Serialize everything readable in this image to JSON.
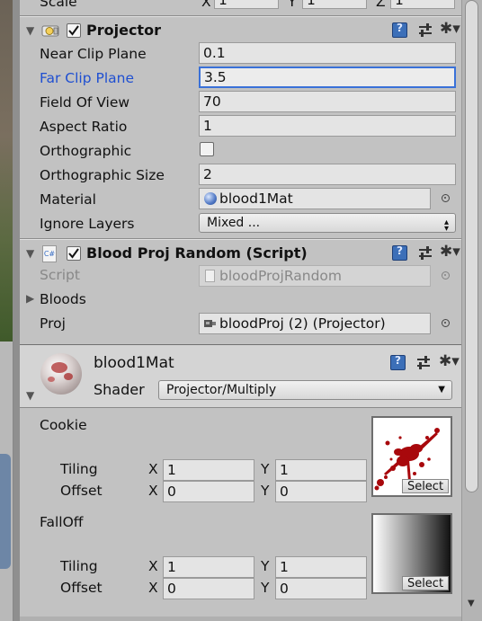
{
  "transform": {
    "scale_label": "Scale",
    "x_label": "X",
    "x_value": "1",
    "y_label": "Y",
    "y_value": "1",
    "z_label": "Z",
    "z_value": "1"
  },
  "projector": {
    "title": "Projector",
    "enabled": true,
    "fields": [
      {
        "label": "Near Clip Plane",
        "value": "0.1"
      },
      {
        "label": "Far Clip Plane",
        "value": "3.5"
      },
      {
        "label": "Field Of View",
        "value": "70"
      },
      {
        "label": "Aspect Ratio",
        "value": "1"
      },
      {
        "label": "Orthographic",
        "value": ""
      },
      {
        "label": "Orthographic Size",
        "value": "2"
      },
      {
        "label": "Material",
        "value": "blood1Mat"
      },
      {
        "label": "Ignore Layers",
        "value": "Mixed ..."
      }
    ]
  },
  "script_component": {
    "title": "Blood Proj Random (Script)",
    "script_label": "Script",
    "script_value": "bloodProjRandom",
    "bloods_label": "Bloods",
    "proj_label": "Proj",
    "proj_value": "bloodProj (2) (Projector)",
    "icon_text": "C#"
  },
  "material": {
    "name": "blood1Mat",
    "shader_label": "Shader",
    "shader_value": "Projector/Multiply",
    "cookie": {
      "label": "Cookie",
      "tiling_label": "Tiling",
      "tiling_x": "1",
      "tiling_y": "1",
      "offset_label": "Offset",
      "offset_x": "0",
      "offset_y": "0",
      "select_label": "Select"
    },
    "falloff": {
      "label": "FallOff",
      "tiling_label": "Tiling",
      "tiling_x": "1",
      "tiling_y": "1",
      "offset_label": "Offset",
      "offset_x": "0",
      "offset_y": "0",
      "select_label": "Select"
    },
    "x_label": "X",
    "y_label": "Y"
  },
  "colors": {
    "panel": "#c2c2c2",
    "focus_label": "#1f4fd1",
    "focus_border": "#3a71d8",
    "blood": "#a8080c"
  }
}
